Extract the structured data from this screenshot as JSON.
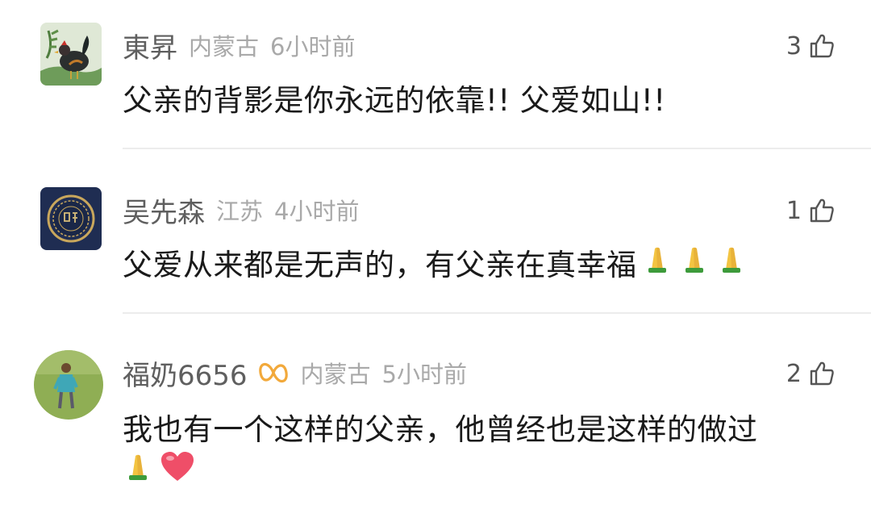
{
  "comments": [
    {
      "name": "東昇",
      "location": "内蒙古",
      "time": "6小时前",
      "likes": "3",
      "text": "父亲的背影是你永远的依靠!! 父爱如山!!",
      "avatar_icon": "rooster-painting-avatar"
    },
    {
      "name": "吴先森",
      "location": "江苏",
      "time": "4小时前",
      "likes": "1",
      "text": "父爱从来都是无声的，有父亲在真幸福",
      "avatar_icon": "seal-medallion-avatar"
    },
    {
      "name": "福奶6656",
      "location": "内蒙古",
      "time": "5小时前",
      "likes": "2",
      "text_line1": "我也有一个这样的父亲，他曾经也是这样的做过",
      "avatar_icon": "person-on-grass-avatar"
    }
  ],
  "colors": {
    "name": "#5f5f5f",
    "meta": "#a9a9a9",
    "text": "#1a1a1a",
    "badge": "#f2a93b",
    "divider": "#ececec"
  }
}
